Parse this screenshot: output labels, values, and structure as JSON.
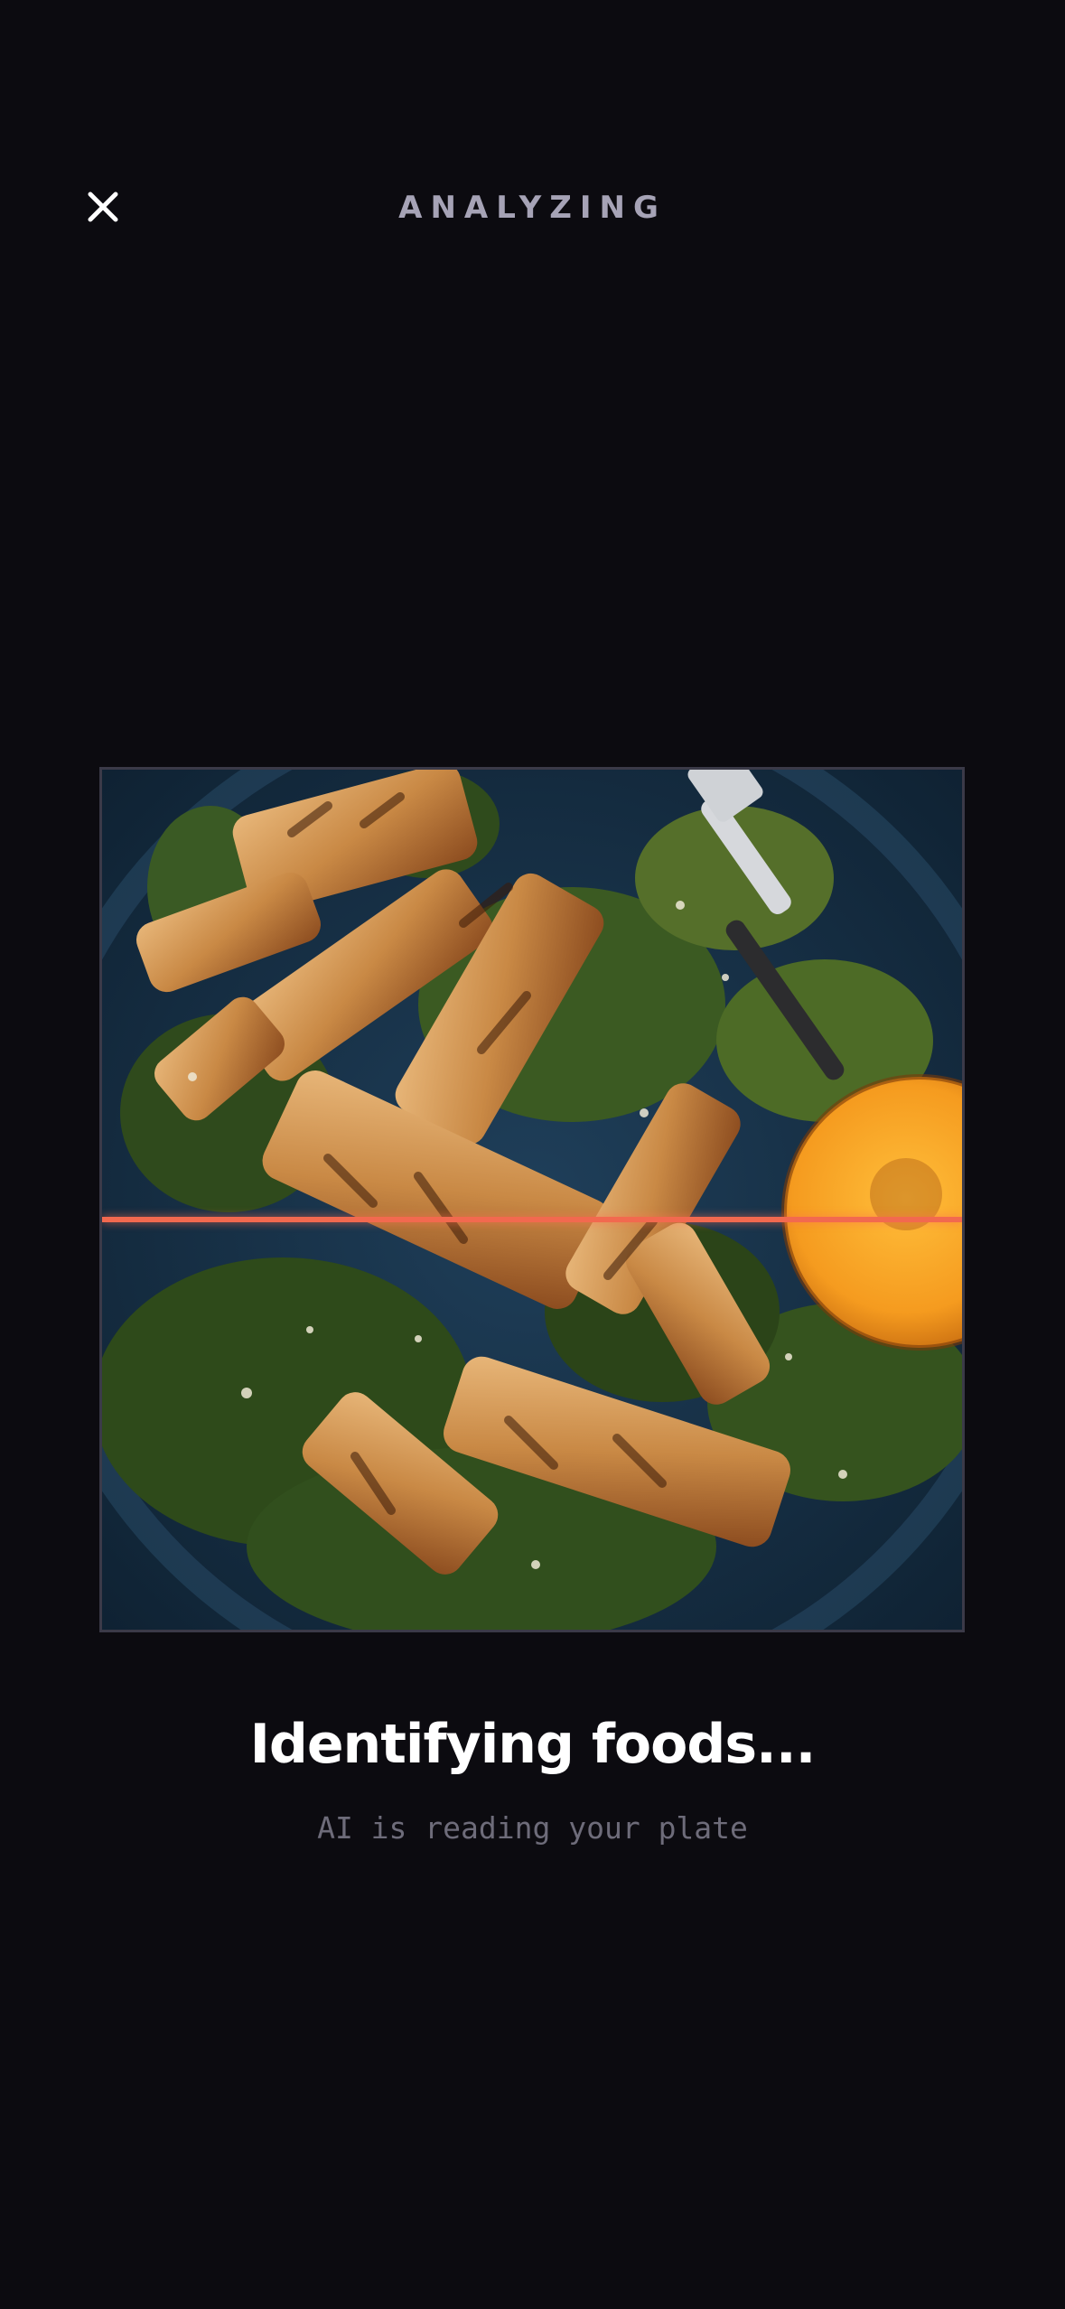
{
  "header": {
    "title": "ANALYZING",
    "close_icon": "close-icon"
  },
  "scan": {
    "image_subject": "grilled chicken salad with kale, lemon and fork",
    "scan_line_color": "#f2694f",
    "progress": 0.52
  },
  "status": {
    "title": "Identifying foods...",
    "subtitle": "AI is reading your plate"
  },
  "colors": {
    "background": "#0c0b10",
    "header_text": "#a6a3b6",
    "title_text": "#ffffff",
    "subtitle_text": "#6e6c7a",
    "accent": "#f2694f"
  }
}
